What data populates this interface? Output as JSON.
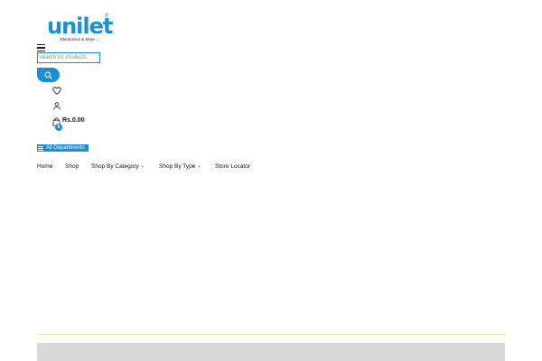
{
  "logo": {
    "wordmark": "unilet",
    "registered": "®",
    "tagline": "Electronics & More ..."
  },
  "search": {
    "placeholder": "Search for Products",
    "value": ""
  },
  "header": {
    "cart_total": "Rs.0.00",
    "cart_count": "0"
  },
  "departments": {
    "label": "All Departments"
  },
  "nav": {
    "items": [
      {
        "label": "Home",
        "has_dropdown": false
      },
      {
        "label": "Shop",
        "has_dropdown": false
      },
      {
        "label": "Shop By Category",
        "has_dropdown": true
      },
      {
        "label": "Shop By Type",
        "has_dropdown": true
      },
      {
        "label": "Store Locator",
        "has_dropdown": false
      }
    ],
    "dropdown_glyph": "⌄"
  },
  "icons": {
    "menu": "hamburger-menu-icon",
    "search": "search-icon",
    "wishlist": "heart-icon",
    "account": "user-icon",
    "cart": "shopping-bag-icon",
    "departments": "list-icon"
  },
  "colors": {
    "accent": "#1b8fd6",
    "divider": "#f2e3a0",
    "footer_band": "#d8d8d8"
  }
}
